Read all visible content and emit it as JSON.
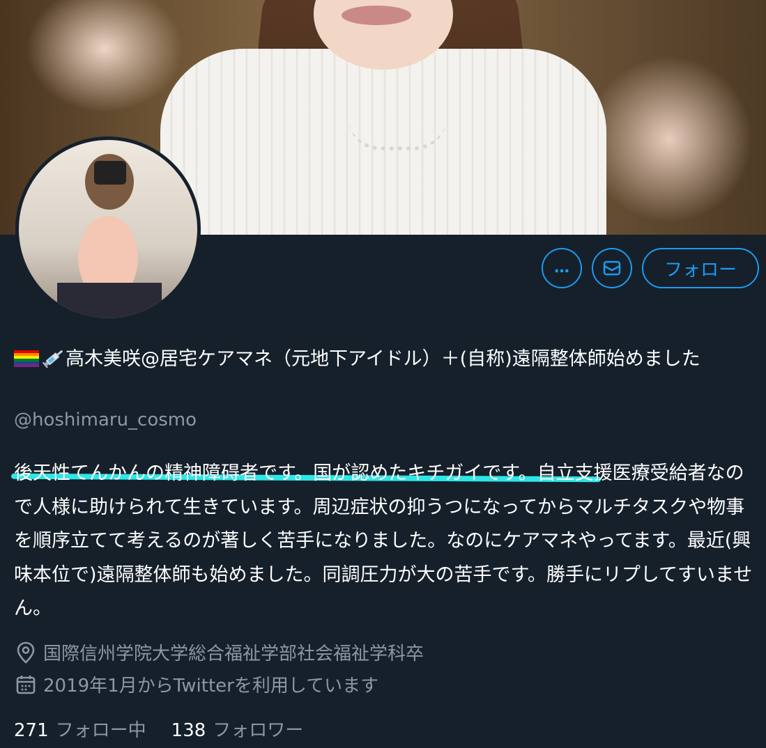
{
  "header": {
    "more_label": "…",
    "message_icon": "envelope-icon",
    "follow_label": "フォロー"
  },
  "profile": {
    "display_name_icons": [
      "rainbow-flag-icon",
      "syringe-icon"
    ],
    "display_name": "高木美咲@居宅ケアマネ（元地下アイドル）＋(自称)遠隔整体師始めました",
    "handle": "@hoshimaru_cosmo",
    "bio_highlighted": "後天性てんかんの精神障碍者です。国が認めたキチガイです",
    "bio_rest": "。自立支援医療受給者なので人様に助けられて生きています。周辺症状の抑うつになってからマルチタスクや物事を順序立てて考えるのが著しく苦手になりました。なのにケアマネやってます。最近(興味本位で)遠隔整体師も始めました。同調圧力が大の苦手です。勝手にリプしてすいません。",
    "location": "国際信州学院大学総合福祉学部社会福祉学科卒",
    "joined": "2019年1月からTwitterを利用しています"
  },
  "stats": {
    "following_count": "271",
    "following_label": "フォロー中",
    "followers_count": "138",
    "followers_label": "フォロワー"
  },
  "colors": {
    "background": "#15202b",
    "accent": "#1d9bf0",
    "muted_text": "#8b98a5",
    "highlight_underline": "#2ee6e6"
  }
}
